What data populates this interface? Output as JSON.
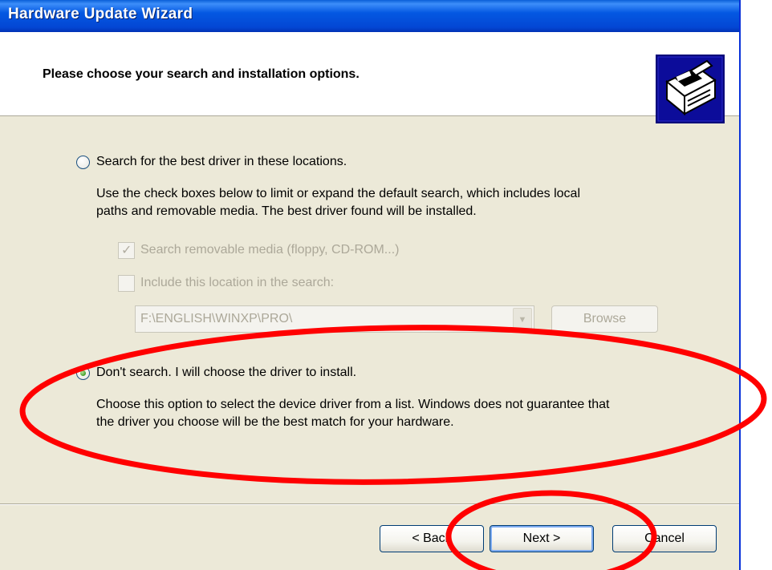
{
  "window": {
    "title": "Hardware Update Wizard"
  },
  "header": {
    "title": "Please choose your search and installation options.",
    "icon": "hardware-install-icon"
  },
  "search_option": {
    "label": "Search for the best driver in these locations.",
    "selected": false,
    "description_line1": "Use the check boxes below to limit or expand the default search, which includes local",
    "description_line2": "paths and removable media. The best driver found will be installed.",
    "removable_media": {
      "label": "Search removable media (floppy, CD-ROM...)",
      "checked": true,
      "enabled": false
    },
    "include_location": {
      "label": "Include this location in the search:",
      "checked": false,
      "enabled": false
    },
    "location_value": "F:\\ENGLISH\\WINXP\\PRO\\",
    "browse_label": "Browse"
  },
  "dont_search_option": {
    "label": "Don't search. I will choose the driver to install.",
    "selected": true,
    "description_line1": "Choose this option to select the device driver from a list.  Windows does not guarantee that",
    "description_line2": "the driver you choose will be the best match for your hardware."
  },
  "footer": {
    "back_label": "< Back",
    "next_label": "Next >",
    "cancel_label": "Cancel"
  },
  "annotation_color": "#ff0000"
}
